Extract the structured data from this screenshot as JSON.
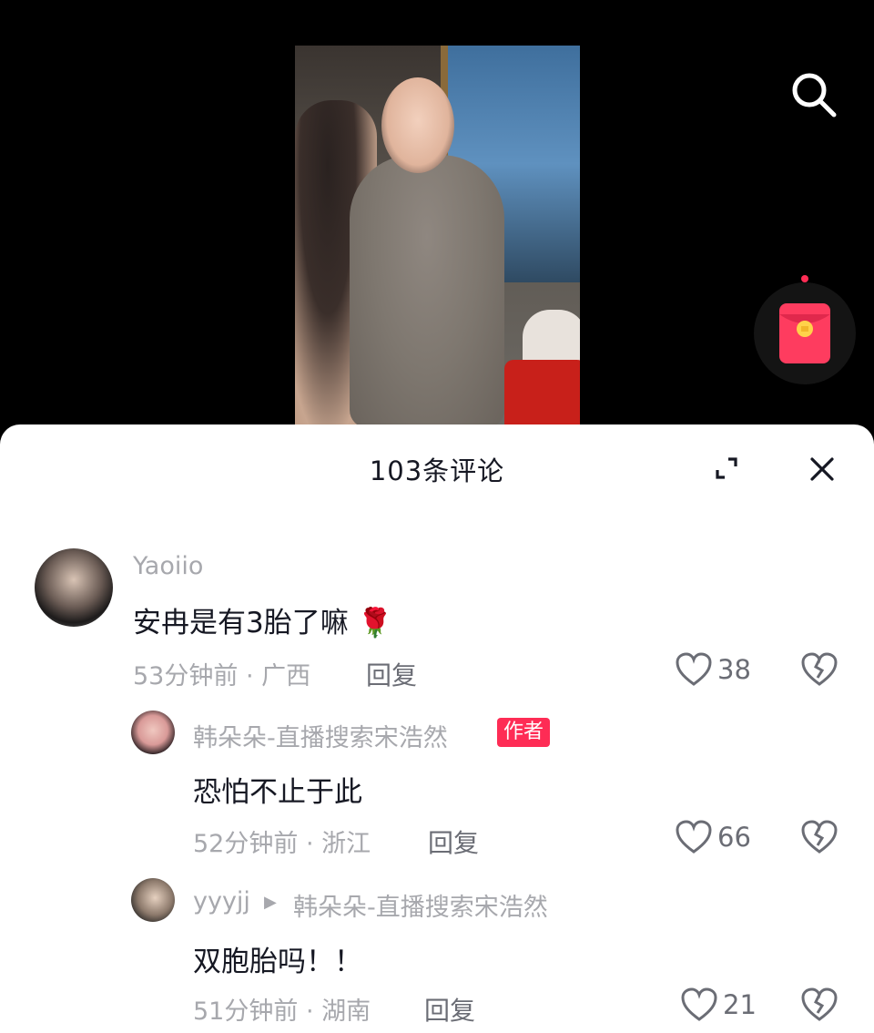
{
  "sheet": {
    "title": "103条评论"
  },
  "icons": {
    "search": "search-icon",
    "red_packet": "red-envelope-icon",
    "expand": "expand-icon",
    "close": "close-icon",
    "like": "heart-icon",
    "dislike": "broken-heart-icon"
  },
  "colors": {
    "accent": "#fe2c55",
    "meta_text": "#a7a8ad"
  },
  "comments": [
    {
      "username": "Yaoiio",
      "text": "安冉是有3胎了嘛",
      "emoji": "🌹",
      "meta": "53分钟前 · 广西",
      "reply_label": "回复",
      "likes": "38"
    },
    {
      "username": "韩朵朵-直播搜索宋浩然",
      "badge": "作者",
      "text": "恐怕不止于此",
      "meta": "52分钟前 · 浙江",
      "reply_label": "回复",
      "likes": "66"
    },
    {
      "username": "yyyjj",
      "reply_to": "韩朵朵-直播搜索宋浩然",
      "text": "双胞胎吗！！",
      "meta": "51分钟前 · 湖南",
      "reply_label": "回复",
      "likes": "21"
    }
  ]
}
